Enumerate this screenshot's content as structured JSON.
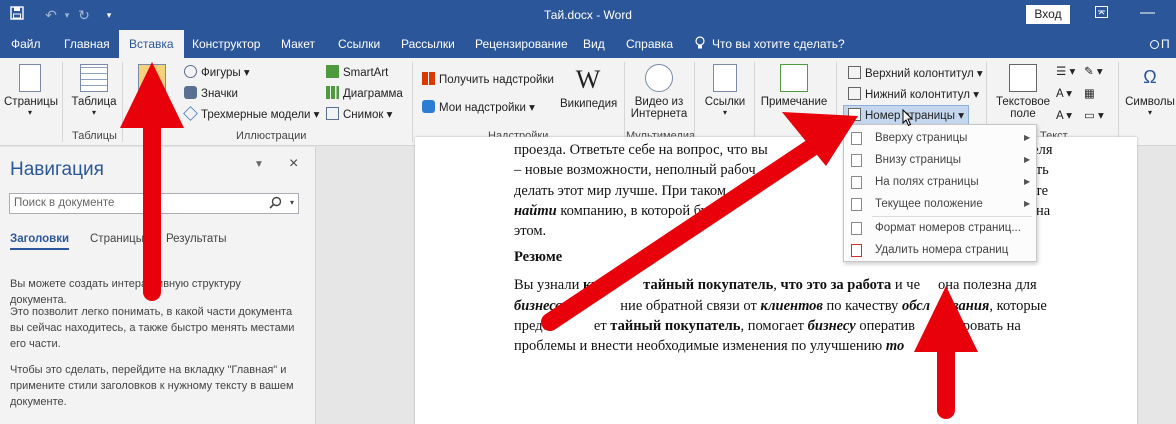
{
  "titlebar": {
    "doc_title": "Тай.docx - Word",
    "signin": "Вход"
  },
  "tabs": [
    "Файл",
    "Главная",
    "Вставка",
    "Конструктор",
    "Макет",
    "Ссылки",
    "Рассылки",
    "Рецензирование",
    "Вид",
    "Справка"
  ],
  "active_tab": "Вставка",
  "tell_me": "Что вы хотите сделать?",
  "share_initial": "П",
  "ribbon": {
    "pages": "Страницы",
    "table": "Таблица",
    "tables_group": "Таблицы",
    "shapes": "Фигуры",
    "icons": "Значки",
    "models3d": "Трехмерные модели",
    "smartart": "SmartArt",
    "chart": "Диаграмма",
    "screenshot": "Снимок",
    "illustrations_group": "Иллюстрации",
    "get_addins": "Получить надстройки",
    "my_addins": "Мои надстройки",
    "wikipedia": "Википедия",
    "wiki_glyph": "W",
    "addins_group": "Надстройки",
    "online_video_1": "Видео из",
    "online_video_2": "Интернета",
    "media_group": "Мультимедиа",
    "links": "Ссылки",
    "comment": "Примечание",
    "header": "Верхний колонтитул",
    "footer": "Нижний колонтитул",
    "page_number": "Номер страницы",
    "text_box_1": "Текстовое",
    "text_box_2": "поле",
    "text_group": "Текст",
    "symbols": "Символы",
    "omega": "Ω"
  },
  "nav": {
    "title": "Навигация",
    "search_placeholder": "Поиск в документе",
    "tabs": [
      "Заголовки",
      "Страницы",
      "Результаты"
    ],
    "p1": "Вы можете создать интерактивную структуру документа.",
    "p2": "Это позволит легко понимать, в какой части документа вы сейчас находитесь, а также быстро менять местами его части.",
    "p3": "Чтобы это сделать, перейдите на вкладку \"Главная\" и примените стили заголовков к нужному тексту в вашем документе."
  },
  "doc": {
    "l1": "проезда. Ответьте себе на вопрос, что вы",
    "l1r": "пателя",
    "l2": "– новые возможности, неполный рабоч",
    "l2r": "жность",
    "l3": "делать этот мир лучше. При таком",
    "l3r": "жете",
    "l4a": "найти",
    "l4b": " компанию, в которой бу",
    "l4r": "на",
    "l5": "этом.",
    "heading": "Резюме",
    "p2l1a": "Вы узнали ",
    "p2l1b": "кто",
    "p2l1c": " тайный покупатель",
    "p2l1d": ", ",
    "p2l1e": "что это за работа",
    "p2l1f": " и че",
    "p2l1g": "она полезна для",
    "p2l2a": "бизнеса",
    "p2l2b": ".  П",
    "p2l2c": "ние обратной связи от ",
    "p2l2d": "клиентов",
    "p2l2e": " по качеству ",
    "p2l2f": "обсл",
    "p2l2g": "ивания",
    "p2l2h": ", которые",
    "p2l3a": "предо",
    "p2l3b": "ет ",
    "p2l3c": "тайный покупатель",
    "p2l3d": ", помогает ",
    "p2l3e": "бизнесу",
    "p2l3f": " оператив",
    "p2l3g": "ировать на",
    "p2l4a": "проблемы и внести необходимые изменения по улучшению ",
    "p2l4b": "то",
    "p2l4c": "луг."
  },
  "menu": [
    {
      "label": "Вверху страницы",
      "submenu": true
    },
    {
      "label": "Внизу страницы",
      "submenu": true
    },
    {
      "label": "На полях страницы",
      "submenu": true
    },
    {
      "label": "Текущее положение",
      "submenu": true
    },
    {
      "label": "Формат номеров страниц...",
      "submenu": false
    },
    {
      "label": "Удалить номера страниц",
      "submenu": false
    }
  ],
  "colors": {
    "brand": "#2b579a",
    "arrow": "#e8000b"
  }
}
